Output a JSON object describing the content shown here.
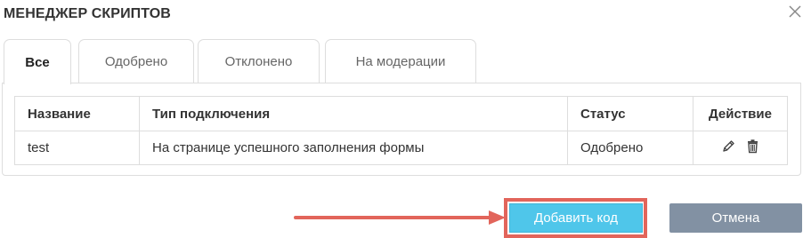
{
  "dialog": {
    "title": "МЕНЕДЖЕР СКРИПТОВ",
    "close_icon": "close-icon"
  },
  "tabs": [
    {
      "label": "Все",
      "active": true
    },
    {
      "label": "Одобрено",
      "active": false
    },
    {
      "label": "Отклонено",
      "active": false
    },
    {
      "label": "На модерации",
      "active": false
    }
  ],
  "table": {
    "headers": {
      "name": "Название",
      "type": "Тип подключения",
      "status": "Статус",
      "action": "Действие"
    },
    "rows": [
      {
        "name": "test",
        "type": "На странице успешного заполнения формы",
        "status": "Одобрено",
        "actions": [
          "edit-pencil-icon",
          "delete-trash-icon"
        ]
      }
    ]
  },
  "buttons": {
    "add": "Добавить код",
    "cancel": "Отмена"
  },
  "colors": {
    "add_button": "#4fc6ea",
    "cancel_button": "#8291a3",
    "annotation": "#e2655b"
  }
}
